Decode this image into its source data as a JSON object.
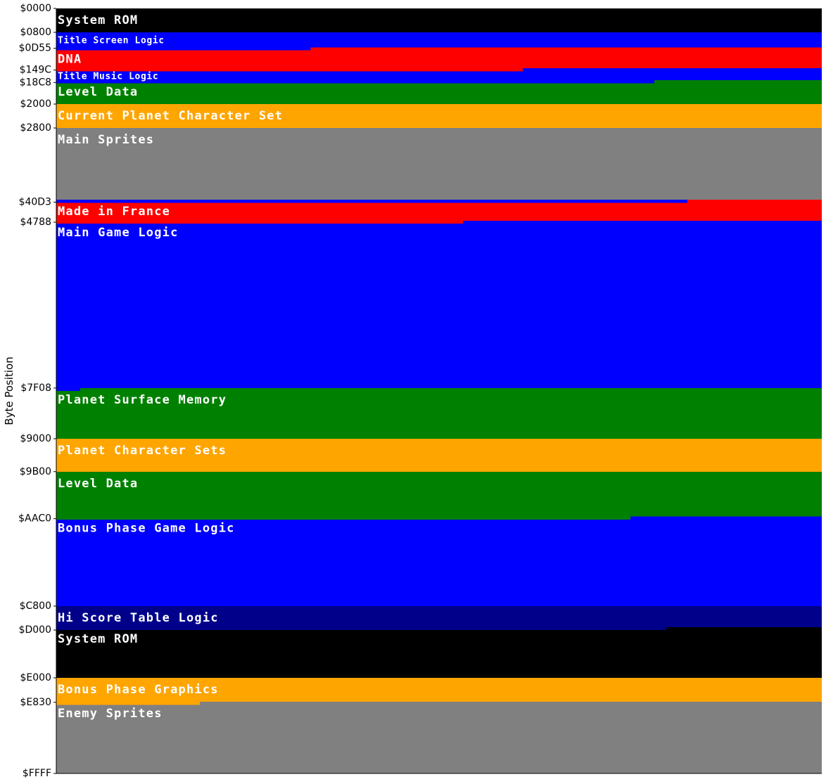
{
  "chart_data": {
    "type": "memory-map",
    "ylabel": "Byte Position",
    "address_range": [
      "$0000",
      "$FFFF"
    ],
    "bytes_per_row": 256,
    "yticks": [
      "$0000",
      "$0800",
      "$0D55",
      "$149C",
      "$18C8",
      "$2000",
      "$2800",
      "$40D3",
      "$4788",
      "$7F08",
      "$9000",
      "$9B00",
      "$AAC0",
      "$C800",
      "$D000",
      "$E000",
      "$E830",
      "$FFFF"
    ],
    "regions": [
      {
        "start": "$0000",
        "end": "$0800",
        "label": "System ROM",
        "color": "#000000"
      },
      {
        "start": "$0800",
        "end": "$0D55",
        "label": "Title Screen Logic",
        "color": "#0000FF",
        "emphasis": "minor"
      },
      {
        "start": "$0D55",
        "end": "$149C",
        "label": "DNA",
        "color": "#FF0000"
      },
      {
        "start": "$149C",
        "end": "$18C8",
        "label": "Title Music Logic",
        "color": "#0000FF",
        "emphasis": "minor"
      },
      {
        "start": "$18C8",
        "end": "$2000",
        "label": "Level Data",
        "color": "#008000"
      },
      {
        "start": "$2000",
        "end": "$2800",
        "label": "Current Planet Character Set",
        "color": "#FFA500"
      },
      {
        "start": "$2800",
        "end": "$4000",
        "label": "Main Sprites",
        "color": "#808080"
      },
      {
        "start": "$4000",
        "end": "$40D3",
        "label": "",
        "color": "#0000FF"
      },
      {
        "start": "$40D3",
        "end": "$4788",
        "label": "Made in France",
        "color": "#FF0000"
      },
      {
        "start": "$4788",
        "end": "$7F08",
        "label": "Main Game Logic",
        "color": "#0000FF"
      },
      {
        "start": "$7F08",
        "end": "$9000",
        "label": "Planet Surface Memory",
        "color": "#008000"
      },
      {
        "start": "$9000",
        "end": "$9B00",
        "label": "Planet Character Sets",
        "color": "#FFA500"
      },
      {
        "start": "$9B00",
        "end": "$AAC0",
        "label": "Level Data",
        "color": "#008000"
      },
      {
        "start": "$AAC0",
        "end": "$C800",
        "label": "Bonus Phase Game Logic",
        "color": "#0000FF"
      },
      {
        "start": "$C800",
        "end": "$CFCC",
        "label": "Hi Score Table Logic",
        "color": "#00008B"
      },
      {
        "start": "$CFCC",
        "end": "$E000",
        "label": "System ROM",
        "color": "#000000"
      },
      {
        "start": "$E000",
        "end": "$E830",
        "label": "Bonus Phase Graphics",
        "color": "#FFA500"
      },
      {
        "start": "$E830",
        "end": "$10000",
        "label": "Enemy Sprites",
        "color": "#808080"
      }
    ]
  }
}
